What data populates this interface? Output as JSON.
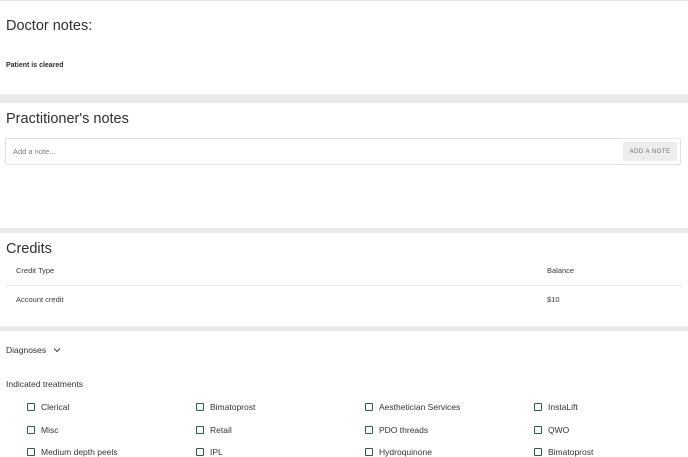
{
  "doctor_notes": {
    "title": "Doctor notes:",
    "note": "Patient is cleared"
  },
  "practitioner_notes": {
    "title": "Practitioner's notes",
    "input_placeholder": "Add a note...",
    "add_button": "ADD A NOTE"
  },
  "credits": {
    "title": "Credits",
    "columns": [
      "Credit Type",
      "Balance"
    ],
    "rows": [
      {
        "type": "Account credit",
        "balance": "$10"
      }
    ]
  },
  "diagnoses": {
    "label": "Diagnoses",
    "toggle_icon": "chevron-down-icon"
  },
  "indicated_treatments": {
    "label": "Indicated treatments",
    "items": [
      [
        "Clerical",
        "Bimatoprost",
        "Aesthetician Services",
        "InstaLift"
      ],
      [
        "Misc",
        "Retail",
        "PDO threads",
        "QWO"
      ],
      [
        "Medium depth peels",
        "IPL",
        "Hydroquinone",
        "Bimatoprost"
      ]
    ]
  },
  "colors": {
    "checkbox_border": "#2e5b52",
    "divider": "#e9e9e9",
    "button_bg": "#ededed"
  }
}
